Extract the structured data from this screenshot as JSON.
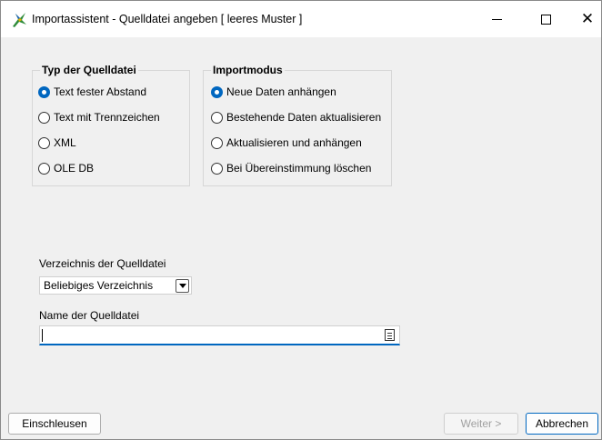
{
  "window": {
    "title": "Importassistent - Quelldatei angeben [ leeres Muster ]"
  },
  "source_type": {
    "title": "Typ der Quelldatei",
    "options": [
      {
        "label": "Text fester Abstand",
        "checked": true
      },
      {
        "label": "Text mit Trennzeichen",
        "checked": false
      },
      {
        "label": "XML",
        "checked": false
      },
      {
        "label": "OLE DB",
        "checked": false
      }
    ]
  },
  "import_mode": {
    "title": "Importmodus",
    "options": [
      {
        "label": "Neue Daten anhängen",
        "checked": true
      },
      {
        "label": "Bestehende Daten aktualisieren",
        "checked": false
      },
      {
        "label": "Aktualisieren und anhängen",
        "checked": false
      },
      {
        "label": "Bei Übereinstimmung löschen",
        "checked": false
      }
    ]
  },
  "directory": {
    "label": "Verzeichnis der Quelldatei",
    "selected": "Beliebiges Verzeichnis"
  },
  "filename": {
    "label": "Name der Quelldatei",
    "value": ""
  },
  "buttons": {
    "einschleusen": "Einschleusen",
    "weiter": "Weiter >",
    "abbrechen": "Abbrechen"
  },
  "colors": {
    "accent": "#0067c0",
    "background": "#f0f0f0"
  },
  "icons": [
    "app-icon",
    "minimize-icon",
    "maximize-icon",
    "close-icon",
    "dropdown-arrow-icon",
    "file-browse-icon"
  ]
}
